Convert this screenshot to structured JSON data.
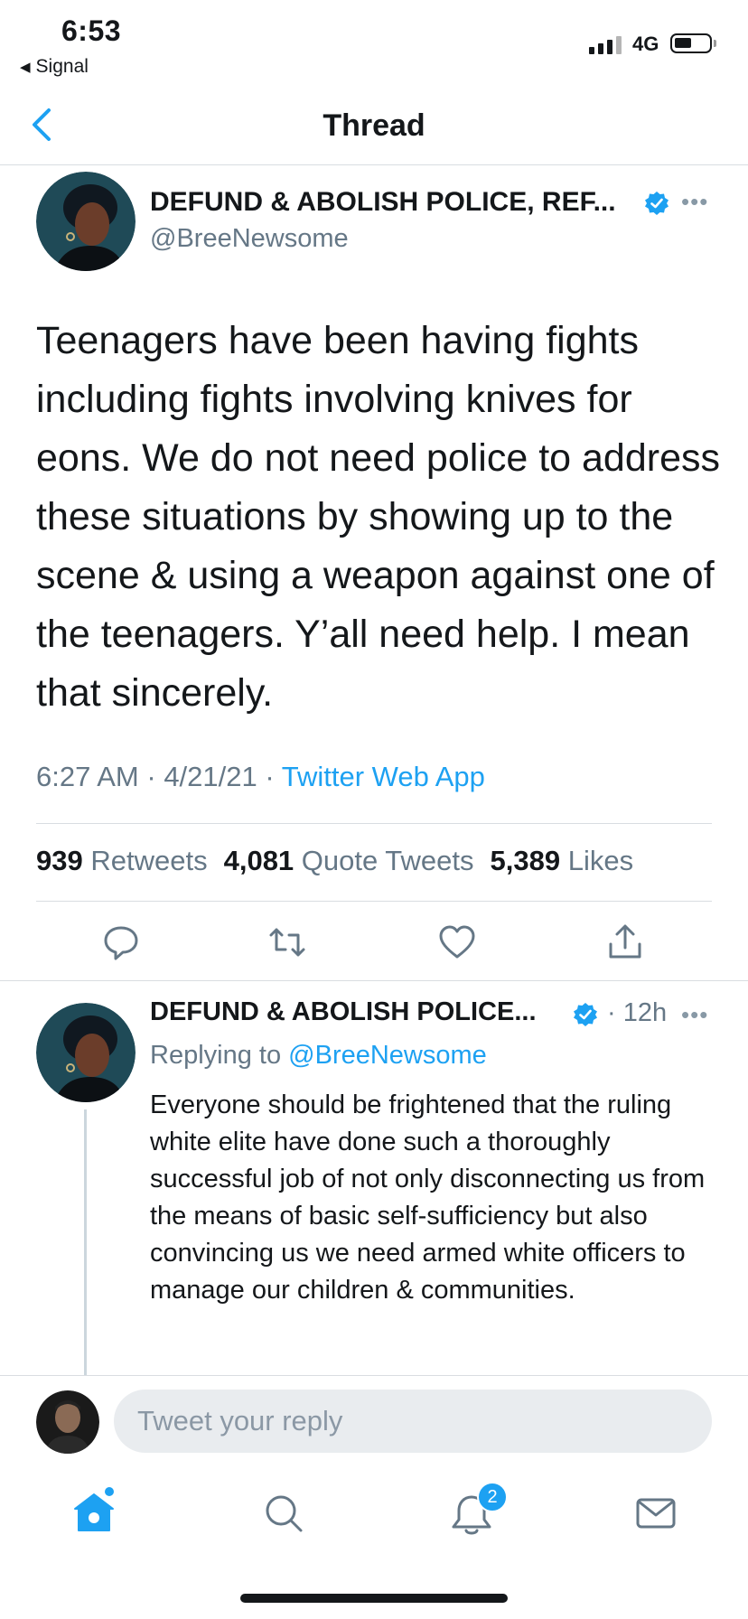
{
  "status_bar": {
    "time": "6:53",
    "back_app": "Signal",
    "network": "4G"
  },
  "header": {
    "title": "Thread",
    "back_icon": "chevron-left-icon"
  },
  "main_tweet": {
    "display_name": "DEFUND & ABOLISH POLICE, REF...",
    "handle": "@BreeNewsome",
    "verified": true,
    "text": "Teenagers have been having fights including fights involving knives for eons. We do not need police to address these situations  by showing up to the scene & using a weapon against one of the teenagers. Y’all need help. I mean that sincerely.",
    "time": "6:27 AM",
    "date": "4/21/21",
    "source": "Twitter Web App",
    "stats": {
      "retweets_count": "939",
      "retweets_label": "Retweets",
      "quotes_count": "4,081",
      "quotes_label": "Quote Tweets",
      "likes_count": "5,389",
      "likes_label": "Likes"
    },
    "actions": [
      "reply-icon",
      "retweet-icon",
      "like-icon",
      "share-icon"
    ]
  },
  "reply_tweet": {
    "display_name": "DEFUND & ABOLISH POLICE...",
    "time": "12h",
    "replying_label": "Replying to",
    "replying_to": "@BreeNewsome",
    "text": "Everyone should be frightened that the ruling white elite have done such a thoroughly successful job of not only disconnecting us from the means of basic self-sufficiency but also convincing us we need armed white officers to manage our children & communities."
  },
  "composer": {
    "placeholder": "Tweet your reply"
  },
  "tab_bar": {
    "items": [
      "home-icon",
      "search-icon",
      "notifications-icon",
      "messages-icon"
    ],
    "notifications_badge": "2"
  },
  "colors": {
    "accent": "#1da1f2",
    "text": "#14171a",
    "secondary": "#657786"
  }
}
